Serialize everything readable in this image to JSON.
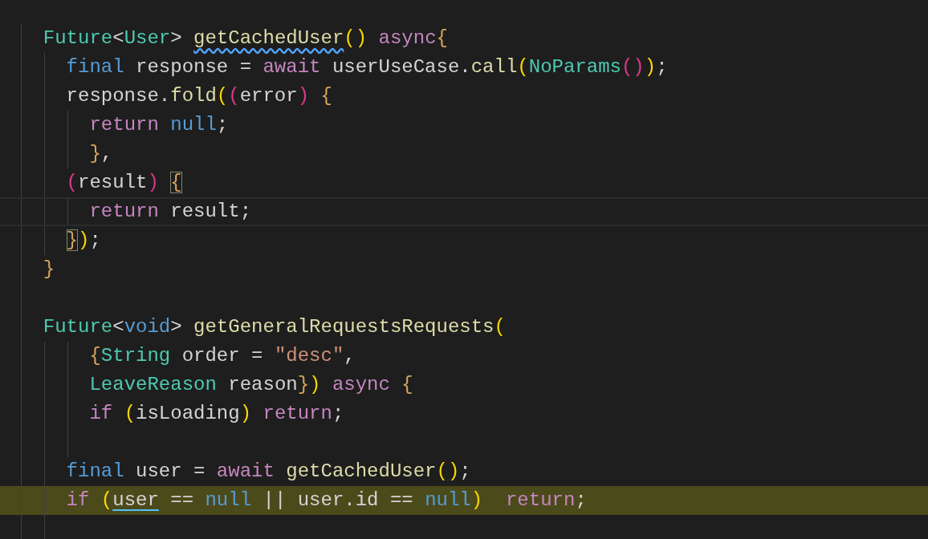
{
  "editor": {
    "lines": [
      {
        "current": false,
        "highlighted": false,
        "tokens": [
          {
            "text": "  Future",
            "kind": "type"
          },
          {
            "text": "<",
            "kind": "plain"
          },
          {
            "text": "User",
            "kind": "type"
          },
          {
            "text": "> ",
            "kind": "plain"
          },
          {
            "text": "getCachedUser",
            "kind": "func",
            "squiggle": true
          },
          {
            "text": "()",
            "kind": "paren1"
          },
          {
            "text": " async",
            "kind": "keyword"
          },
          {
            "text": "{",
            "kind": "brace"
          }
        ]
      },
      {
        "current": false,
        "highlighted": false,
        "tokens": [
          {
            "text": "    final",
            "kind": "storage"
          },
          {
            "text": " response = ",
            "kind": "plain"
          },
          {
            "text": "await",
            "kind": "keyword"
          },
          {
            "text": " userUseCase.",
            "kind": "plain"
          },
          {
            "text": "call",
            "kind": "func"
          },
          {
            "text": "(",
            "kind": "paren1"
          },
          {
            "text": "NoParams",
            "kind": "type"
          },
          {
            "text": "()",
            "kind": "paren2"
          },
          {
            "text": ")",
            "kind": "paren1"
          },
          {
            "text": ";",
            "kind": "plain"
          }
        ]
      },
      {
        "current": false,
        "highlighted": false,
        "tokens": [
          {
            "text": "    response.",
            "kind": "plain"
          },
          {
            "text": "fold",
            "kind": "func"
          },
          {
            "text": "(",
            "kind": "paren1"
          },
          {
            "text": "(",
            "kind": "paren2"
          },
          {
            "text": "error",
            "kind": "plain"
          },
          {
            "text": ")",
            "kind": "paren2"
          },
          {
            "text": " {",
            "kind": "brace"
          }
        ]
      },
      {
        "current": false,
        "highlighted": false,
        "tokens": [
          {
            "text": "      return",
            "kind": "keyword"
          },
          {
            "text": " null",
            "kind": "storage"
          },
          {
            "text": ";",
            "kind": "plain"
          }
        ]
      },
      {
        "current": false,
        "highlighted": false,
        "tokens": [
          {
            "text": "      }",
            "kind": "brace"
          },
          {
            "text": ",",
            "kind": "plain"
          }
        ]
      },
      {
        "current": false,
        "highlighted": false,
        "tokens": [
          {
            "text": "    (",
            "kind": "paren2"
          },
          {
            "text": "result",
            "kind": "plain"
          },
          {
            "text": ") ",
            "kind": "paren2"
          },
          {
            "text": "{",
            "kind": "brace",
            "bracket_match": true
          }
        ]
      },
      {
        "current": true,
        "highlighted": false,
        "tokens": [
          {
            "text": "      return",
            "kind": "keyword"
          },
          {
            "text": " result;",
            "kind": "plain"
          }
        ]
      },
      {
        "current": false,
        "highlighted": false,
        "tokens": [
          {
            "text": "    }",
            "kind": "brace",
            "bracket_match": true
          },
          {
            "text": ")",
            "kind": "paren1"
          },
          {
            "text": ";",
            "kind": "plain"
          }
        ]
      },
      {
        "current": false,
        "highlighted": false,
        "tokens": [
          {
            "text": "  }",
            "kind": "brace"
          }
        ]
      },
      {
        "current": false,
        "highlighted": false
      },
      {
        "current": false,
        "highlighted": false,
        "tokens": [
          {
            "text": "  Future",
            "kind": "type"
          },
          {
            "text": "<",
            "kind": "plain"
          },
          {
            "text": "void",
            "kind": "storage"
          },
          {
            "text": "> ",
            "kind": "plain"
          },
          {
            "text": "getGeneralRequestsRequests",
            "kind": "func"
          },
          {
            "text": "(",
            "kind": "paren1"
          }
        ]
      },
      {
        "current": false,
        "highlighted": false,
        "tokens": [
          {
            "text": "      {",
            "kind": "brace"
          },
          {
            "text": "String",
            "kind": "type"
          },
          {
            "text": " order = ",
            "kind": "plain"
          },
          {
            "text": "\"desc\"",
            "kind": "string"
          },
          {
            "text": ",",
            "kind": "plain"
          }
        ]
      },
      {
        "current": false,
        "highlighted": false,
        "tokens": [
          {
            "text": "      LeaveReason",
            "kind": "type"
          },
          {
            "text": " reason",
            "kind": "plain"
          },
          {
            "text": "}",
            "kind": "brace"
          },
          {
            "text": ")",
            "kind": "paren1"
          },
          {
            "text": " async",
            "kind": "keyword"
          },
          {
            "text": " {",
            "kind": "brace"
          }
        ]
      },
      {
        "current": false,
        "highlighted": false,
        "tokens": [
          {
            "text": "      if",
            "kind": "keyword"
          },
          {
            "text": " (",
            "kind": "paren1"
          },
          {
            "text": "isLoading",
            "kind": "plain"
          },
          {
            "text": ")",
            "kind": "paren1"
          },
          {
            "text": " return",
            "kind": "keyword"
          },
          {
            "text": ";",
            "kind": "plain"
          }
        ]
      },
      {
        "current": false,
        "highlighted": false
      },
      {
        "current": false,
        "highlighted": false,
        "tokens": [
          {
            "text": "    final",
            "kind": "storage"
          },
          {
            "text": " user = ",
            "kind": "plain"
          },
          {
            "text": "await",
            "kind": "keyword"
          },
          {
            "text": " getCachedUser",
            "kind": "func"
          },
          {
            "text": "()",
            "kind": "paren1"
          },
          {
            "text": ";",
            "kind": "plain"
          }
        ]
      },
      {
        "current": false,
        "highlighted": true,
        "tokens": [
          {
            "text": "    if",
            "kind": "keyword"
          },
          {
            "text": " (",
            "kind": "paren1"
          },
          {
            "text": "user",
            "kind": "plain",
            "link": true
          },
          {
            "text": " == ",
            "kind": "plain"
          },
          {
            "text": "null",
            "kind": "storage"
          },
          {
            "text": " || user.id == ",
            "kind": "plain"
          },
          {
            "text": "null",
            "kind": "storage"
          },
          {
            "text": ")",
            "kind": "paren1"
          },
          {
            "text": "  return",
            "kind": "keyword"
          },
          {
            "text": ";",
            "kind": "plain"
          }
        ]
      },
      {
        "current": false,
        "highlighted": false
      }
    ]
  }
}
